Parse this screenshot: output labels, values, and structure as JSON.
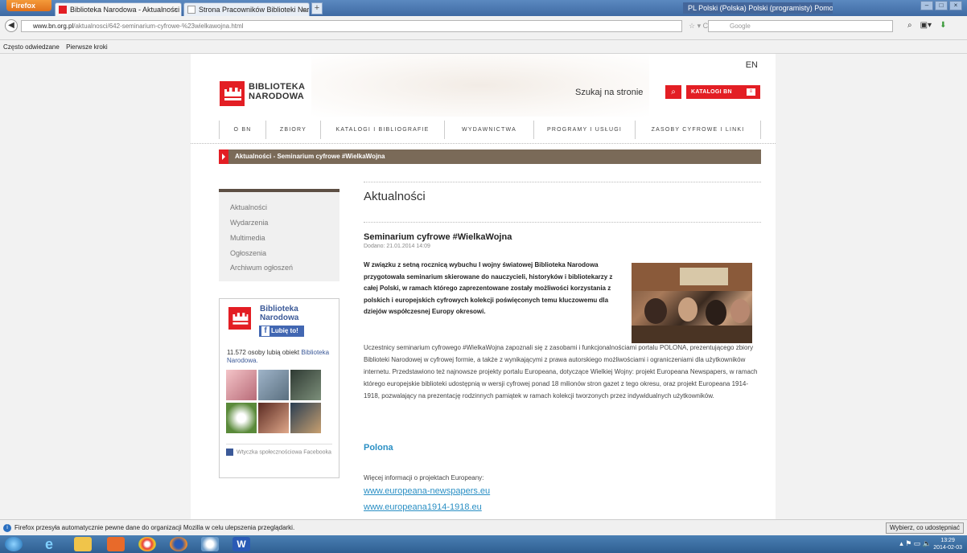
{
  "browser": {
    "app_button": "Firefox",
    "tabs": [
      {
        "label": "Biblioteka Narodowa - Aktualności - ..."
      },
      {
        "label": "Strona Pracowników Biblioteki Narod..."
      }
    ],
    "new_tab": "+",
    "language_bar": "PL Polski (Polska)   Polski (programisty)   Pomoc",
    "url_domain": "www.bn.org.pl",
    "url_path": "/aktualnosci/642-seminarium-cyfrowe-%23wielkawojna.html",
    "search_engine": "Google",
    "bookmarks": [
      "Często odwiedzane",
      "Pierwsze kroki"
    ],
    "notification": "Firefox przesyła automatycznie pewne dane do organizacji Mozilla w celu ulepszenia przeglądarki.",
    "notification_button": "Wybierz, co udostępniać",
    "clock_time": "13:29",
    "clock_date": "2014-02-03"
  },
  "site": {
    "lang_switch": "EN",
    "logo_line1": "BIBLIOTEKA",
    "logo_line2": "NARODOWA",
    "search_label": "Szukaj na stronie",
    "katalog_button": "KATALOGI BN",
    "menu": [
      "O BN",
      "ZBIORY",
      "KATALOGI I BIBLIOGRAFIE",
      "WYDAWNICTWA",
      "PROGRAMY I USŁUGI",
      "ZASOBY CYFROWE I LINKI"
    ],
    "breadcrumb": "Aktualności  - Seminarium cyfrowe #WielkaWojna"
  },
  "sidebar": {
    "items": [
      "Aktualności",
      "Wydarzenia",
      "Multimedia",
      "Ogłoszenia",
      "Archiwum ogłoszeń"
    ]
  },
  "facebook": {
    "page_name_1": "Biblioteka",
    "page_name_2": "Narodowa",
    "like_button": "Lubię to!",
    "count_text": "11.572 osoby lubią obiekt ",
    "count_link": "Biblioteka Narodowa.",
    "footer": "Wtyczka społecznościowa Facebooka"
  },
  "article": {
    "section_title": "Aktualności",
    "title": "Seminarium cyfrowe #WielkaWojna",
    "date": "Dodano: 21.01.2014 14:09",
    "lead": "W związku z setną rocznicą wybuchu I wojny światowej Biblioteka Narodowa przygotowała seminarium skierowane do nauczycieli, historyków i bibliotekarzy z całej Polski, w ramach którego zaprezentowane zostały możliwości korzystania z polskich i europejskich cyfrowych kolekcji poświęconych temu kluczowemu dla dziejów współczesnej Europy okresowi.",
    "body": "Uczestnicy seminarium cyfrowego #WielkaWojna zapoznali się z zasobami i funkcjonalnościami portalu POLONA, prezentującego zbiory Biblioteki Narodowej w cyfrowej formie, a także z wynikającymi z prawa autorskiego możliwościami i ograniczeniami dla użytkowników internetu. Przedstawiono też najnowsze projekty portalu Europeana, dotyczące Wielkiej Wojny: projekt Europeana Newspapers, w ramach którego europejskie biblioteki udostępnią w wersji cyfrowej ponad 18 milionów stron gazet z tego okresu, oraz projekt Europeana 1914-1918, pozwalający na prezentację rodzinnych pamiątek w ramach kolekcji tworzonych przez indywidualnych użytkowników.",
    "polona_link": "Polona",
    "more_info": "Więcej informacji o projektach Europeany:",
    "link1": "www.europeana-newspapers.eu",
    "link2": "www.europeana1914-1918.eu"
  },
  "colors": {
    "brand_red": "#e31e24",
    "breadcrumb_brown": "#7a6a58",
    "link_blue": "#2a8fc4"
  }
}
